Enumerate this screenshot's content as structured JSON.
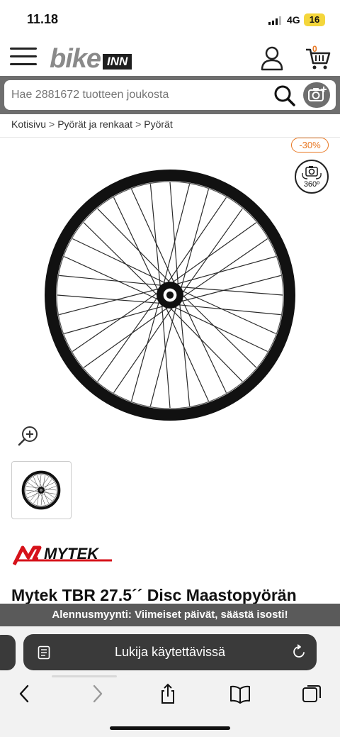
{
  "status_bar": {
    "time": "11.18",
    "network": "4G",
    "battery": "16"
  },
  "header": {
    "logo_bike": "bike",
    "logo_inn": "INN",
    "cart_count": "0"
  },
  "search": {
    "placeholder": "Hae 2881672 tuotteen joukosta"
  },
  "breadcrumb": {
    "items": [
      "Kotisivu",
      "Pyörät ja renkaat",
      "Pyörät"
    ]
  },
  "product": {
    "discount": "-30%",
    "view360_label": "360º",
    "brand": "MYTEK",
    "title": "Mytek TBR 27.5´´ Disc Maastopyörän"
  },
  "promo": {
    "text": "Alennusmyynti: Viimeiset päivät, säästä isosti!"
  },
  "browser": {
    "address_text": "Lukija käytettävissä"
  },
  "icons": [
    "menu-icon",
    "user-icon",
    "cart-icon",
    "search-icon",
    "camera-plus-icon",
    "rotate-360-icon",
    "zoom-in-icon",
    "reader-icon",
    "reload-icon",
    "back-icon",
    "forward-icon",
    "share-icon",
    "bookmarks-icon",
    "tabs-icon"
  ],
  "colors": {
    "accent": "#e87722",
    "promo_bg": "#5a5a5a",
    "search_frame": "#6e6e6e",
    "brand_red": "#d6121a"
  }
}
